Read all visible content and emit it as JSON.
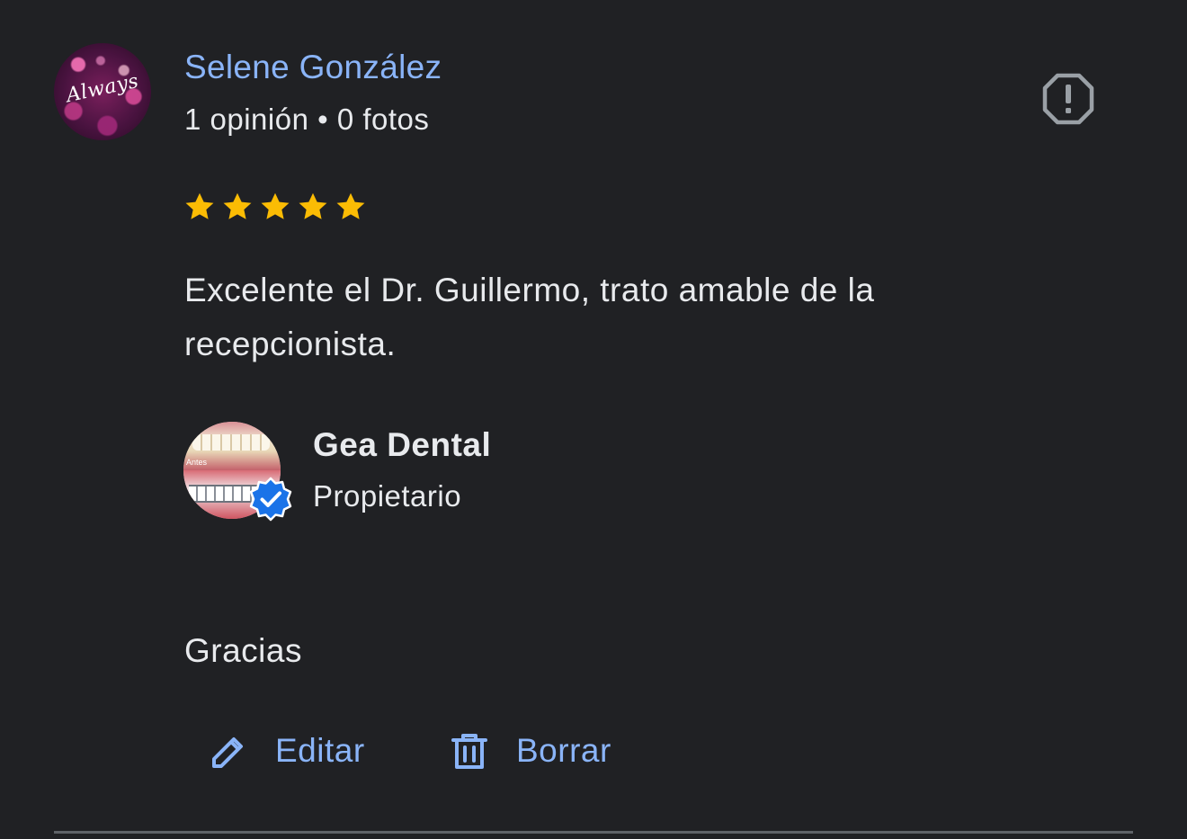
{
  "review": {
    "author": {
      "name": "Selene González",
      "meta": "1 opinión • 0 fotos",
      "avatar_text": "Always"
    },
    "rating": 5,
    "text": "Excelente el Dr. Guillermo, trato amable de la recepcionista.",
    "report_icon": "report-icon"
  },
  "owner_reply": {
    "name": "Gea Dental",
    "role": "Propietario",
    "avatar_text": "Antes",
    "verified_icon": "verified-badge-icon",
    "text": "Gracias"
  },
  "actions": {
    "edit_label": "Editar",
    "delete_label": "Borrar",
    "edit_icon": "pencil-icon",
    "delete_icon": "trash-icon"
  },
  "colors": {
    "background": "#202124",
    "link": "#8ab4f8",
    "text": "#e8eaed",
    "star": "#fbbc04",
    "verified": "#1a73e8"
  }
}
